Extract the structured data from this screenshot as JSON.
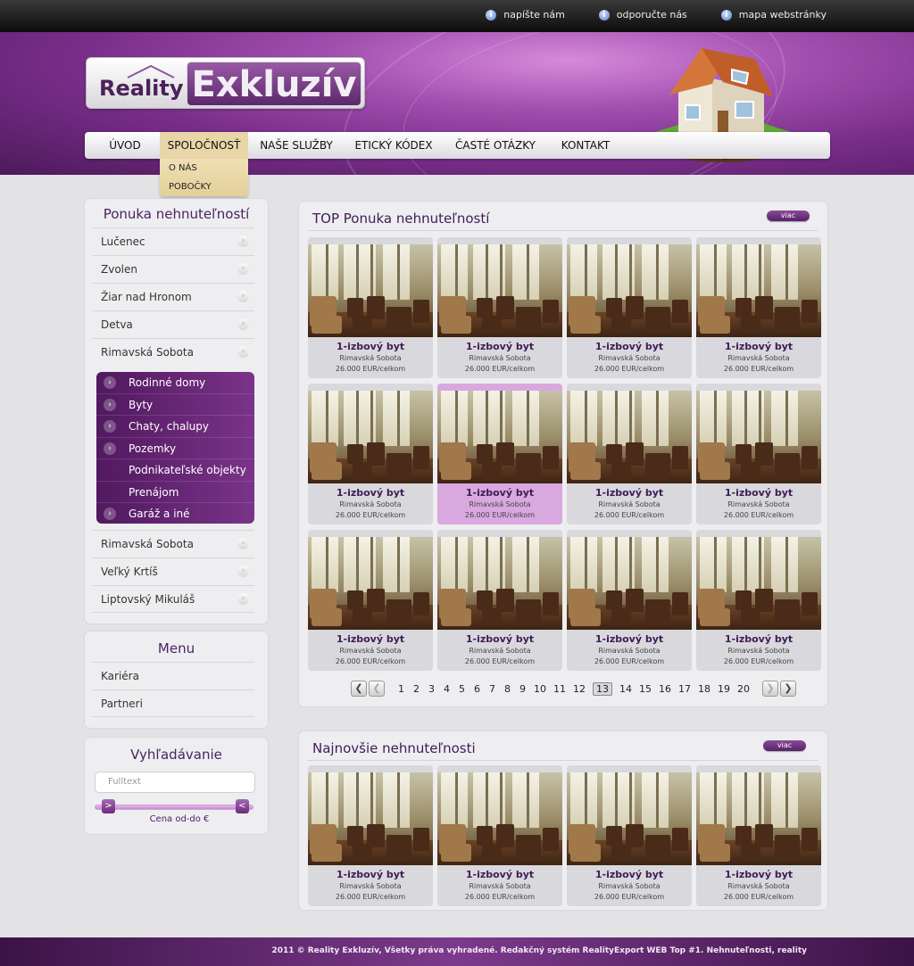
{
  "top_links": [
    {
      "label": "napíšte nám",
      "icon": "info-icon"
    },
    {
      "label": "odporučte nás",
      "icon": "info-icon"
    },
    {
      "label": "mapa webstránky",
      "icon": "info-icon"
    }
  ],
  "logo": {
    "reality": "Reality",
    "exkluziv": "Exkluzív"
  },
  "nav": {
    "items": [
      "ÚVOD",
      "SPOLOČNOSŤ",
      "NAŠE SLUŽBY",
      "ETICKÝ KÓDEX",
      "ČASTÉ OTÁZKY",
      "KONTAKT"
    ],
    "active_index": 1,
    "submenu": [
      "O NÁS",
      "POBOČKY"
    ]
  },
  "sidebar": {
    "offers": {
      "title": "Ponuka nehnuteľností",
      "cities_top": [
        "Lučenec",
        "Zvolen",
        "Žiar nad Hronom",
        "Detva",
        "Rimavská Sobota"
      ],
      "expanded": [
        {
          "label": "Rodinné domy",
          "chevron": true
        },
        {
          "label": "Byty",
          "chevron": true
        },
        {
          "label": "Chaty, chalupy",
          "chevron": true
        },
        {
          "label": "Pozemky",
          "chevron": true
        },
        {
          "label": "Podnikateľské objekty",
          "chevron": false
        },
        {
          "label": "Prenájom",
          "chevron": false
        },
        {
          "label": "Garáž a iné",
          "chevron": true
        }
      ],
      "cities_bottom": [
        "Rimavská Sobota",
        "Veľký Krtíš",
        "Liptovský Mikuláš"
      ]
    },
    "menu": {
      "title": "Menu",
      "items": [
        "Kariéra",
        "Partneri"
      ]
    },
    "search": {
      "title": "Vyhľadávanie",
      "placeholder": "Fulltext",
      "price_label": "Cena od-do €"
    }
  },
  "top_offers": {
    "title": "TOP Ponuka nehnuteľností",
    "more": "viac",
    "card": {
      "title": "1-izbový byt",
      "location": "Rimavská Sobota",
      "price": "26.000 EUR/celkom"
    },
    "highlighted_index": 5,
    "pager": {
      "pages": [
        "1",
        "2",
        "3",
        "4",
        "5",
        "6",
        "7",
        "8",
        "9",
        "10",
        "11",
        "12",
        "13",
        "14",
        "15",
        "16",
        "17",
        "18",
        "19",
        "20"
      ],
      "current": "13"
    }
  },
  "newest": {
    "title": "Najnovšie nehnuteľnosti",
    "more": "viac",
    "card": {
      "title": "1-izbový byt",
      "location": "Rimavská Sobota",
      "price": "26.000 EUR/celkom"
    }
  },
  "footer": {
    "text": "2011 © Reality Exkluzív, Všetky práva vyhradené. Redakčný systém RealityExport WEB Top #1. Nehnuteľnosti, reality"
  },
  "colors": {
    "brand_purple": "#5a2a6a",
    "highlight": "#d9a8df",
    "submenu": "#e8d6a8"
  }
}
